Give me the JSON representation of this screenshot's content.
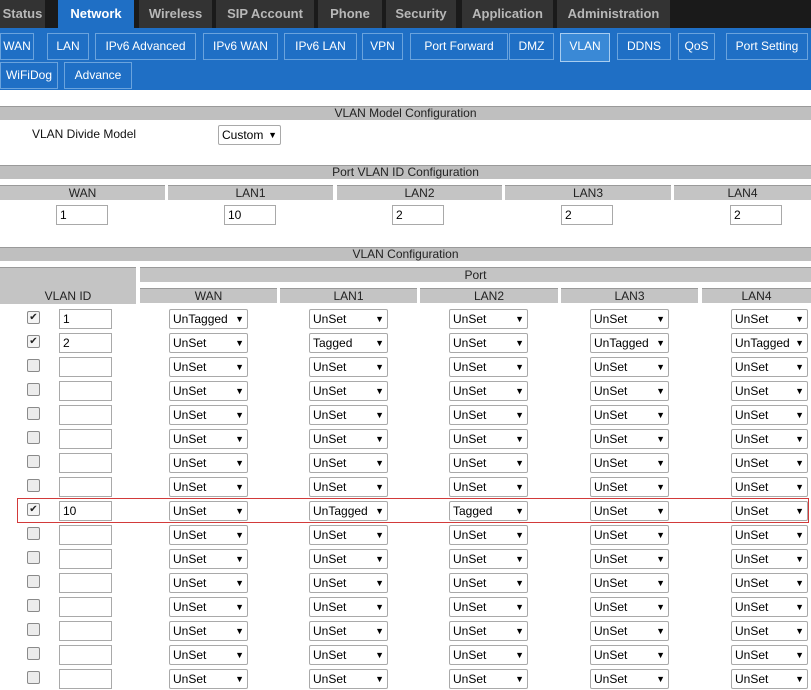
{
  "top_tabs": [
    {
      "label": "Status",
      "active": false
    },
    {
      "label": "Network",
      "active": true
    },
    {
      "label": "Wireless",
      "active": false
    },
    {
      "label": "SIP Account",
      "active": false
    },
    {
      "label": "Phone",
      "active": false
    },
    {
      "label": "Security",
      "active": false
    },
    {
      "label": "Application",
      "active": false
    },
    {
      "label": "Administration",
      "active": false
    }
  ],
  "sub_tabs": [
    {
      "label": "WAN",
      "active": false
    },
    {
      "label": "LAN",
      "active": false
    },
    {
      "label": "IPv6 Advanced",
      "active": false
    },
    {
      "label": "IPv6 WAN",
      "active": false
    },
    {
      "label": "IPv6 LAN",
      "active": false
    },
    {
      "label": "VPN",
      "active": false
    },
    {
      "label": "Port Forward",
      "active": false
    },
    {
      "label": "DMZ",
      "active": false
    },
    {
      "label": "VLAN",
      "active": true
    },
    {
      "label": "DDNS",
      "active": false
    },
    {
      "label": "QoS",
      "active": false
    },
    {
      "label": "Port Setting",
      "active": false
    },
    {
      "label": "WiFiDog",
      "active": false
    },
    {
      "label": "Advance",
      "active": false
    }
  ],
  "model": {
    "section_title": "VLAN Model Configuration",
    "label": "VLAN Divide Model",
    "value": "Custom"
  },
  "pvid": {
    "section_title": "Port VLAN ID Configuration",
    "ports": [
      {
        "name": "WAN",
        "value": "1"
      },
      {
        "name": "LAN1",
        "value": "10"
      },
      {
        "name": "LAN2",
        "value": "2"
      },
      {
        "name": "LAN3",
        "value": "2"
      },
      {
        "name": "LAN4",
        "value": "2"
      }
    ]
  },
  "vlan": {
    "section_title": "VLAN Configuration",
    "vlan_id_header": "VLAN ID",
    "port_header": "Port",
    "port_columns": [
      "WAN",
      "LAN1",
      "LAN2",
      "LAN3",
      "LAN4"
    ],
    "highlight_row": 8,
    "rows": [
      {
        "checked": true,
        "id": "1",
        "ports": [
          "UnTagged",
          "UnSet",
          "UnSet",
          "UnSet",
          "UnSet"
        ]
      },
      {
        "checked": true,
        "id": "2",
        "ports": [
          "UnSet",
          "Tagged",
          "UnSet",
          "UnTagged",
          "UnTagged"
        ]
      },
      {
        "checked": false,
        "id": "",
        "ports": [
          "UnSet",
          "UnSet",
          "UnSet",
          "UnSet",
          "UnSet"
        ]
      },
      {
        "checked": false,
        "id": "",
        "ports": [
          "UnSet",
          "UnSet",
          "UnSet",
          "UnSet",
          "UnSet"
        ]
      },
      {
        "checked": false,
        "id": "",
        "ports": [
          "UnSet",
          "UnSet",
          "UnSet",
          "UnSet",
          "UnSet"
        ]
      },
      {
        "checked": false,
        "id": "",
        "ports": [
          "UnSet",
          "UnSet",
          "UnSet",
          "UnSet",
          "UnSet"
        ]
      },
      {
        "checked": false,
        "id": "",
        "ports": [
          "UnSet",
          "UnSet",
          "UnSet",
          "UnSet",
          "UnSet"
        ]
      },
      {
        "checked": false,
        "id": "",
        "ports": [
          "UnSet",
          "UnSet",
          "UnSet",
          "UnSet",
          "UnSet"
        ]
      },
      {
        "checked": true,
        "id": "10",
        "ports": [
          "UnSet",
          "UnTagged",
          "Tagged",
          "UnSet",
          "UnSet"
        ]
      },
      {
        "checked": false,
        "id": "",
        "ports": [
          "UnSet",
          "UnSet",
          "UnSet",
          "UnSet",
          "UnSet"
        ]
      },
      {
        "checked": false,
        "id": "",
        "ports": [
          "UnSet",
          "UnSet",
          "UnSet",
          "UnSet",
          "UnSet"
        ]
      },
      {
        "checked": false,
        "id": "",
        "ports": [
          "UnSet",
          "UnSet",
          "UnSet",
          "UnSet",
          "UnSet"
        ]
      },
      {
        "checked": false,
        "id": "",
        "ports": [
          "UnSet",
          "UnSet",
          "UnSet",
          "UnSet",
          "UnSet"
        ]
      },
      {
        "checked": false,
        "id": "",
        "ports": [
          "UnSet",
          "UnSet",
          "UnSet",
          "UnSet",
          "UnSet"
        ]
      },
      {
        "checked": false,
        "id": "",
        "ports": [
          "UnSet",
          "UnSet",
          "UnSet",
          "UnSet",
          "UnSet"
        ]
      },
      {
        "checked": false,
        "id": "",
        "ports": [
          "UnSet",
          "UnSet",
          "UnSet",
          "UnSet",
          "UnSet"
        ]
      }
    ]
  },
  "icons": {
    "dropdown_arrow": "▼",
    "checkmark": "✔"
  }
}
